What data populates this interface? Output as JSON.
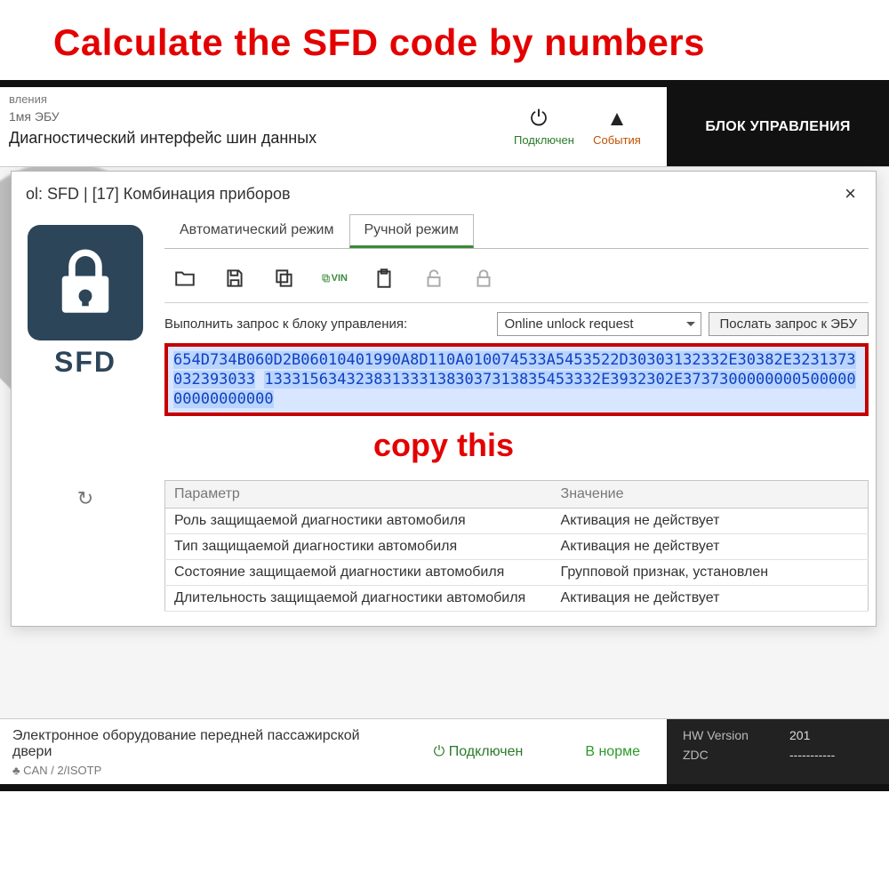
{
  "top_caption": "Calculate the SFD code by numbers",
  "header": {
    "line1": "вления",
    "line2": "1мя ЭБУ",
    "line3": "Диагностический интерфейс шин данных",
    "connected": "Подключен",
    "events": "События",
    "block_title": "БЛОК УПРАВЛЕНИЯ"
  },
  "dialog": {
    "title": "ol: SFD | [17] Комбинация приборов",
    "tabs": {
      "auto": "Автоматический режим",
      "manual": "Ручной режим"
    },
    "sfd_label": "SFD",
    "request_label": "Выполнить запрос к блоку управления:",
    "request_option": "Online unlock request",
    "send_button": "Послать запрос к ЭБУ",
    "hex_line1": "654D734B060D2B06010401990A8D110A010074533A5453522D30303132332E30382E3231373032393033",
    "hex_line2": "1333156343238313331383037313835453332E3932302E373730000000050000000000000000",
    "copy_this": "copy this",
    "table": {
      "col_param": "Параметр",
      "col_value": "Значение",
      "rows": [
        {
          "p": "Роль защищаемой диагностики автомобиля",
          "v": "Активация не действует"
        },
        {
          "p": "Тип защищаемой диагностики автомобиля",
          "v": "Активация не действует"
        },
        {
          "p": "Состояние защищаемой диагностики автомобиля",
          "v": "Групповой признак, установлен"
        },
        {
          "p": "Длительность защищаемой диагностики автомобиля",
          "v": "Активация не действует"
        }
      ]
    }
  },
  "footer": {
    "main": "Электронное оборудование передней пассажирской двери",
    "sub": "♣ CAN / 2/ISOTP",
    "status1_icon": "⏻",
    "status1": "Подключен",
    "status2": "В норме",
    "hw_label": "HW Version",
    "hw_value": "201",
    "zdc_label": "ZDC",
    "zdc_value": "-----------"
  }
}
